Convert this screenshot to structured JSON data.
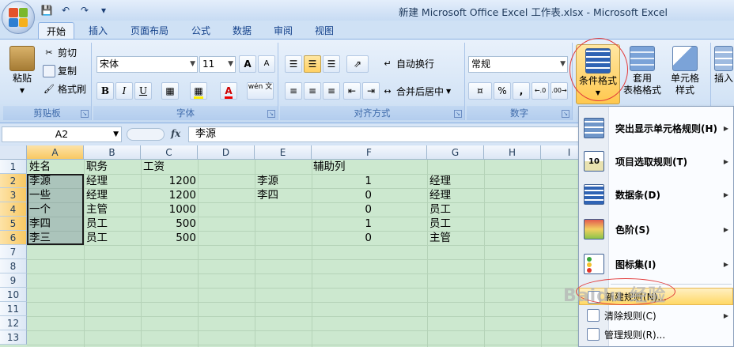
{
  "window": {
    "title": "新建 Microsoft Office Excel 工作表.xlsx - Microsoft Excel",
    "qat": [
      "save-icon",
      "undo-icon",
      "redo-icon",
      "customize-icon"
    ]
  },
  "tabs": [
    "开始",
    "插入",
    "页面布局",
    "公式",
    "数据",
    "审阅",
    "视图"
  ],
  "ribbon": {
    "clipboard": {
      "label": "剪贴板",
      "paste": "粘贴",
      "cut": "剪切",
      "copy": "复制",
      "format_painter": "格式刷"
    },
    "font": {
      "label": "字体",
      "name": "宋体",
      "size": "11",
      "bold": "B",
      "italic": "I",
      "underline": "U",
      "grow": "A",
      "shrink": "A",
      "phonetic": "wén 文"
    },
    "alignment": {
      "label": "对齐方式",
      "wrap": "自动换行",
      "merge": "合并后居中"
    },
    "number": {
      "label": "数字",
      "format": "常规",
      "percent": "%",
      "comma": ",",
      "inc": "←.0",
      "dec": ".00→"
    },
    "styles": {
      "conditional": "条件格式",
      "table_1": "套用",
      "table_2": "表格格式",
      "cell_1": "单元格",
      "cell_2": "样式"
    },
    "cells": {
      "insert": "插入"
    }
  },
  "formula_bar": {
    "name_box": "A2",
    "fx": "fx",
    "content": "李源"
  },
  "sheet": {
    "columns": [
      "A",
      "B",
      "C",
      "D",
      "E",
      "F",
      "G",
      "H",
      "I"
    ],
    "rows": [
      "1",
      "2",
      "3",
      "4",
      "5",
      "6",
      "7",
      "8",
      "9",
      "10",
      "11",
      "12",
      "13"
    ],
    "cells": [
      [
        "姓名",
        "职务",
        "工资",
        "",
        "",
        "辅助列",
        "",
        "",
        ""
      ],
      [
        "李源",
        "经理",
        "1200",
        "",
        "李源",
        "1",
        "经理",
        "",
        ""
      ],
      [
        "一些",
        "经理",
        "1200",
        "",
        "李四",
        "0",
        "经理",
        "",
        ""
      ],
      [
        "一个",
        "主管",
        "1000",
        "",
        "",
        "0",
        "员工",
        "",
        ""
      ],
      [
        "李四",
        "员工",
        "500",
        "",
        "",
        "1",
        "员工",
        "",
        ""
      ],
      [
        "李三",
        "员工",
        "500",
        "",
        "",
        "0",
        "主管",
        "",
        ""
      ]
    ]
  },
  "menu": {
    "items": [
      {
        "label": "突出显示单元格规则(H)",
        "icon": "highlight-rules-icon",
        "submenu": true
      },
      {
        "label": "项目选取规则(T)",
        "icon": "top-bottom-rules-icon",
        "submenu": true
      },
      {
        "label": "数据条(D)",
        "icon": "data-bars-icon",
        "submenu": true
      },
      {
        "label": "色阶(S)",
        "icon": "color-scales-icon",
        "submenu": true
      },
      {
        "label": "图标集(I)",
        "icon": "icon-sets-icon",
        "submenu": true
      },
      {
        "label": "新建规则(N)...",
        "icon": "new-rule-icon",
        "submenu": false
      },
      {
        "label": "清除规则(C)",
        "icon": "clear-rules-icon",
        "submenu": true
      },
      {
        "label": "管理规则(R)...",
        "icon": "manage-rules-icon",
        "submenu": false
      }
    ]
  },
  "watermark": "Baidu 经验",
  "colors": {
    "accent_red": "#e23a3a",
    "selection": "#f8c863",
    "grid_bg": "#cce8cf"
  }
}
